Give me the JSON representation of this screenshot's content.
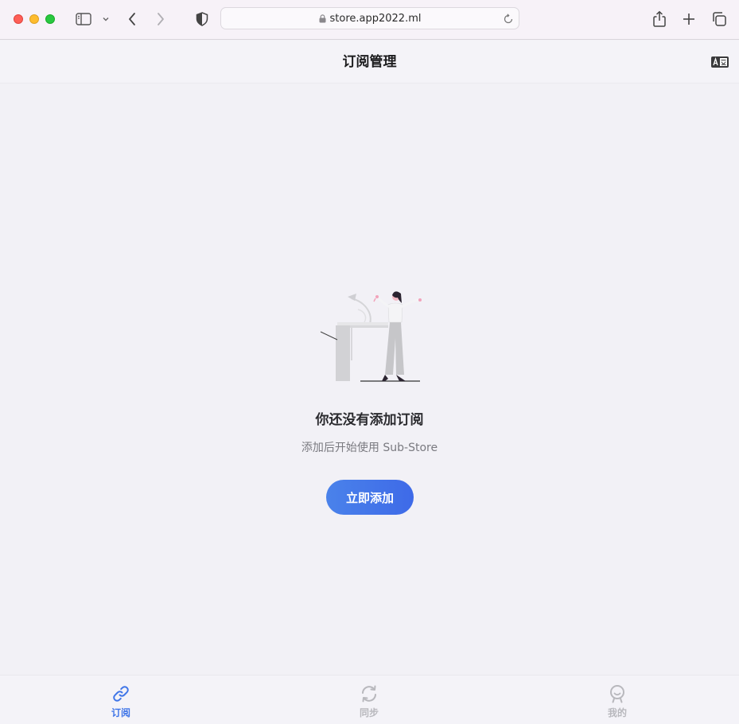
{
  "browser": {
    "url": "store.app2022.ml"
  },
  "header": {
    "title": "订阅管理"
  },
  "empty_state": {
    "title": "你还没有添加订阅",
    "subtitle": "添加后开始使用 Sub-Store",
    "button_label": "立即添加"
  },
  "tabs": [
    {
      "label": "订阅",
      "icon": "link-icon",
      "active": true
    },
    {
      "label": "同步",
      "icon": "sync-icon",
      "active": false
    },
    {
      "label": "我的",
      "icon": "profile-icon",
      "active": false
    }
  ],
  "colors": {
    "accent": "#3f75e8",
    "background": "#f2f1f6",
    "inactive_tab": "#b8b8bd"
  }
}
